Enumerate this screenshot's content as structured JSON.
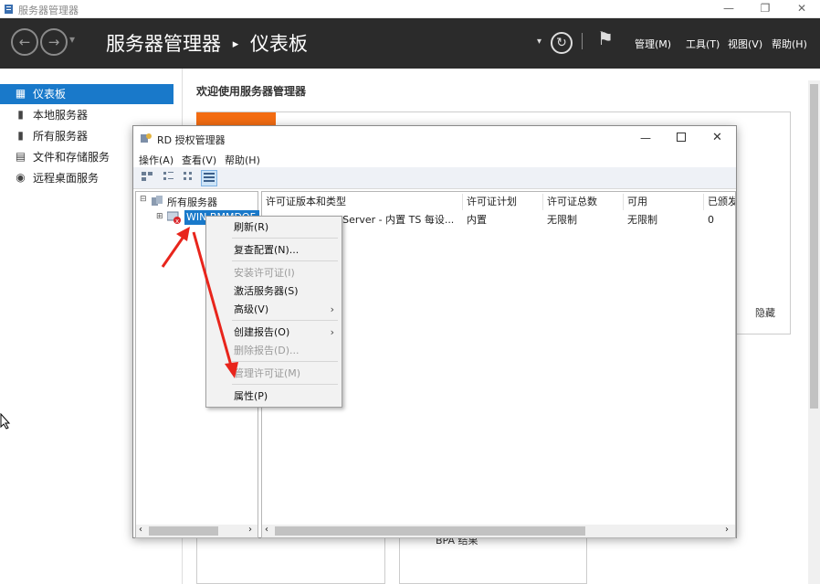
{
  "window": {
    "title": "服务器管理器",
    "minimize": "—",
    "maximize": "❐",
    "close": "✕"
  },
  "header": {
    "back_icon": "←",
    "forward_icon": "→",
    "dropdown_icon": "▾",
    "breadcrumb_root": "服务器管理器",
    "breadcrumb_sep": "▸",
    "breadcrumb_page": "仪表板",
    "refresh_icon": "↻",
    "flag_icon": "⚑",
    "menus": [
      "管理(M)",
      "工具(T)",
      "视图(V)",
      "帮助(H)"
    ]
  },
  "sidebar": {
    "items": [
      {
        "label": "仪表板",
        "icon": "dashboard-icon",
        "glyph": "▦",
        "selected": true
      },
      {
        "label": "本地服务器",
        "icon": "server-icon",
        "glyph": "▮",
        "selected": false
      },
      {
        "label": "所有服务器",
        "icon": "servers-icon",
        "glyph": "▮",
        "selected": false
      },
      {
        "label": "文件和存储服务",
        "icon": "storage-icon",
        "glyph": "▤",
        "selected": false
      },
      {
        "label": "远程桌面服务",
        "icon": "remote-desktop-icon",
        "glyph": "◉",
        "selected": false
      }
    ]
  },
  "main": {
    "welcome": "欢迎使用服务器管理器",
    "hide": "隐藏",
    "bpa": "BPA 结果"
  },
  "dialog": {
    "title": "RD 授权管理器",
    "menu": [
      "操作(A)",
      "查看(V)",
      "帮助(H)"
    ],
    "tree_root": "所有服务器",
    "tree_node": "WIN-BMMDOF",
    "columns": [
      "许可证版本和类型",
      "许可证计划",
      "许可证总数",
      "可用",
      "已颁发"
    ],
    "row": [
      "Windows 2019 Server - 内置 TS 每设...",
      "内置",
      "无限制",
      "无限制",
      "0"
    ]
  },
  "context_menu": {
    "items": [
      {
        "label": "刷新(R)",
        "disabled": false,
        "submenu": false
      },
      {
        "label": "复查配置(N)...",
        "disabled": false,
        "submenu": false
      },
      {
        "label": "安装许可证(I)",
        "disabled": true,
        "submenu": false
      },
      {
        "label": "激活服务器(S)",
        "disabled": false,
        "submenu": false
      },
      {
        "label": "高级(V)",
        "disabled": false,
        "submenu": true
      },
      {
        "label": "创建报告(O)",
        "disabled": false,
        "submenu": true
      },
      {
        "label": "删除报告(D)...",
        "disabled": true,
        "submenu": false
      },
      {
        "label": "管理许可证(M)",
        "disabled": true,
        "submenu": false
      },
      {
        "label": "属性(P)",
        "disabled": false,
        "submenu": false
      }
    ],
    "submenu_glyph": "›"
  },
  "colors": {
    "accent": "#1979ca",
    "header_bg": "#2b2b2b",
    "orange": "#f36c12",
    "arrow": "#e8251c"
  }
}
